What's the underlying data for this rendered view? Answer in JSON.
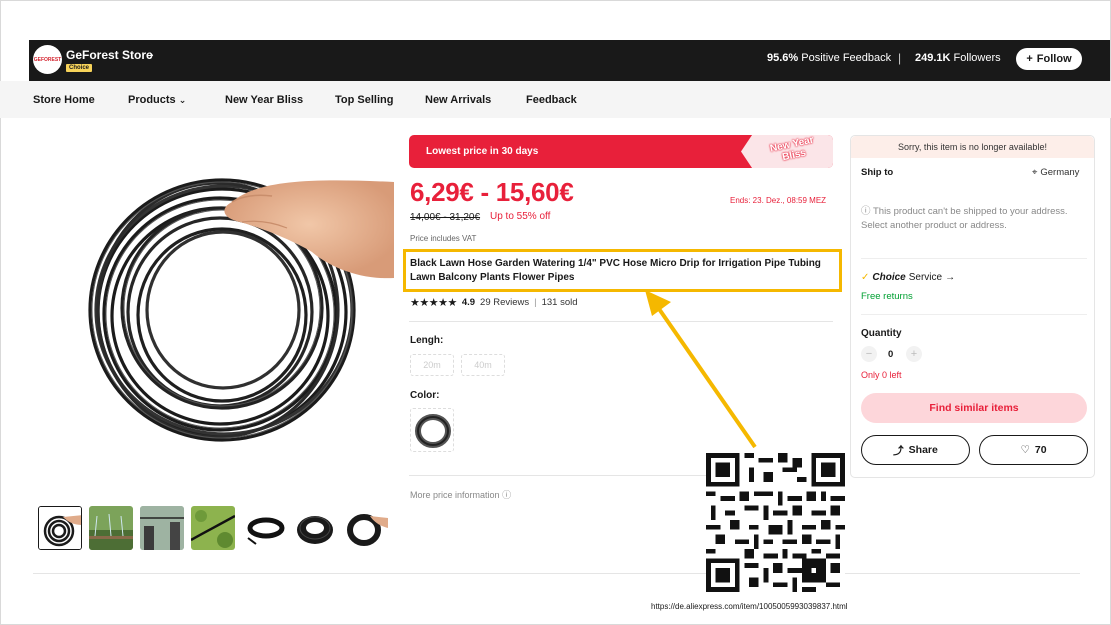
{
  "store": {
    "logo_text": "GEFOREST",
    "name": "GeForest Store",
    "choice_badge": "Choice",
    "feedback_value": "95.6%",
    "feedback_label": "Positive Feedback",
    "separator": "|",
    "followers_value": "249.1K",
    "followers_label": "Followers",
    "follow_label": "Follow"
  },
  "nav": {
    "items": [
      {
        "label": "Store Home"
      },
      {
        "label": "Products"
      },
      {
        "label": "New Year Bliss"
      },
      {
        "label": "Top Selling"
      },
      {
        "label": "New Arrivals"
      },
      {
        "label": "Feedback"
      }
    ]
  },
  "product": {
    "promo_text": "Lowest price in 30 days",
    "promo_tag": "New Year Bliss",
    "price_range": "6,29€ - 15,60€",
    "ends": "Ends: 23. Dez., 08:59 MEZ",
    "original_price": "14,00€ - 31,20€",
    "discount": "Up to 55% off",
    "vat": "Price includes VAT",
    "title": "Black Lawn Hose Garden Watering 1/4\" PVC Hose Micro Drip for Irrigation Pipe Tubing Lawn Balcony Plants Flower Pipes",
    "rating": "4.9",
    "reviews": "29 Reviews",
    "rating_sep": "|",
    "sold": "131 sold",
    "lengh_label": "Lengh:",
    "lengh_options": [
      "20m",
      "40m"
    ],
    "color_label": "Color:",
    "more_price": "More price information"
  },
  "side": {
    "unavailable": "Sorry, this item is no longer available!",
    "ship_to_label": "Ship to",
    "ship_country": "Germany",
    "ship_note_1": "This product can't be shipped to your address.",
    "ship_note_2": "Select another product or address.",
    "choice_label": "Choice",
    "service_label": "Service",
    "free_returns": "Free returns",
    "quantity_label": "Quantity",
    "quantity_value": "0",
    "minus": "−",
    "plus": "+",
    "only_left": "Only 0 left",
    "similar_label": "Find similar items",
    "share_label": "Share",
    "wishlist_count": "70"
  },
  "annotation": {
    "url": "https://de.aliexpress.com/item/1005005993039837.html",
    "highlight_color": "#f5b800"
  },
  "colors": {
    "accent_red": "#e8203a",
    "dark_bar": "#191919",
    "success_green": "#00a032"
  }
}
